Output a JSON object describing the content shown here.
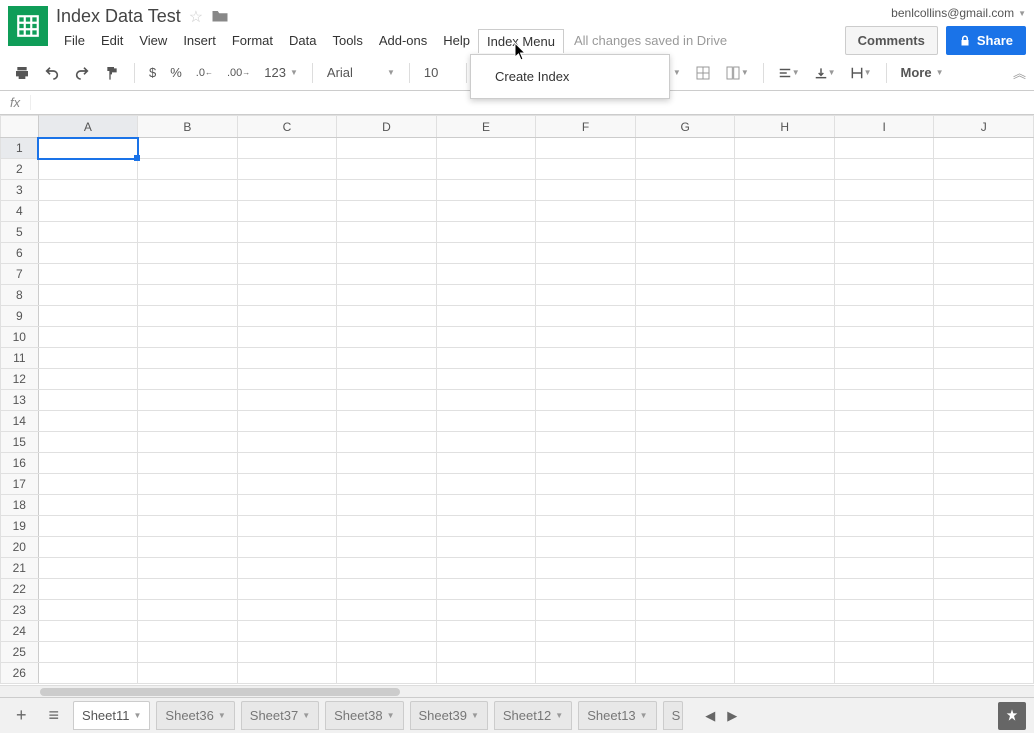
{
  "doc": {
    "title": "Index Data Test"
  },
  "account": {
    "email": "benlcollins@gmail.com"
  },
  "buttons": {
    "comments": "Comments",
    "share": "Share"
  },
  "menubar": [
    "File",
    "Edit",
    "View",
    "Insert",
    "Format",
    "Data",
    "Tools",
    "Add-ons",
    "Help",
    "Index Menu"
  ],
  "save_status": "All changes saved in Drive",
  "dropdown": {
    "items": [
      "Create Index"
    ]
  },
  "toolbar": {
    "currency": "$",
    "percent": "%",
    "dec_dec": ".0",
    "dec_inc": ".00",
    "more_formats": "123",
    "font": "Arial",
    "font_size": "10",
    "more": "More"
  },
  "formula_bar": {
    "label": "fx",
    "value": ""
  },
  "columns": [
    "A",
    "B",
    "C",
    "D",
    "E",
    "F",
    "G",
    "H",
    "I",
    "J"
  ],
  "rows": [
    1,
    2,
    3,
    4,
    5,
    6,
    7,
    8,
    9,
    10,
    11,
    12,
    13,
    14,
    15,
    16,
    17,
    18,
    19,
    20,
    21,
    22,
    23,
    24,
    25,
    26
  ],
  "selected": {
    "col": "A",
    "row": 1
  },
  "sheets": {
    "tabs": [
      "Sheet11",
      "Sheet36",
      "Sheet37",
      "Sheet38",
      "Sheet39",
      "Sheet12",
      "Sheet13"
    ],
    "partial": "S",
    "active": "Sheet11"
  }
}
